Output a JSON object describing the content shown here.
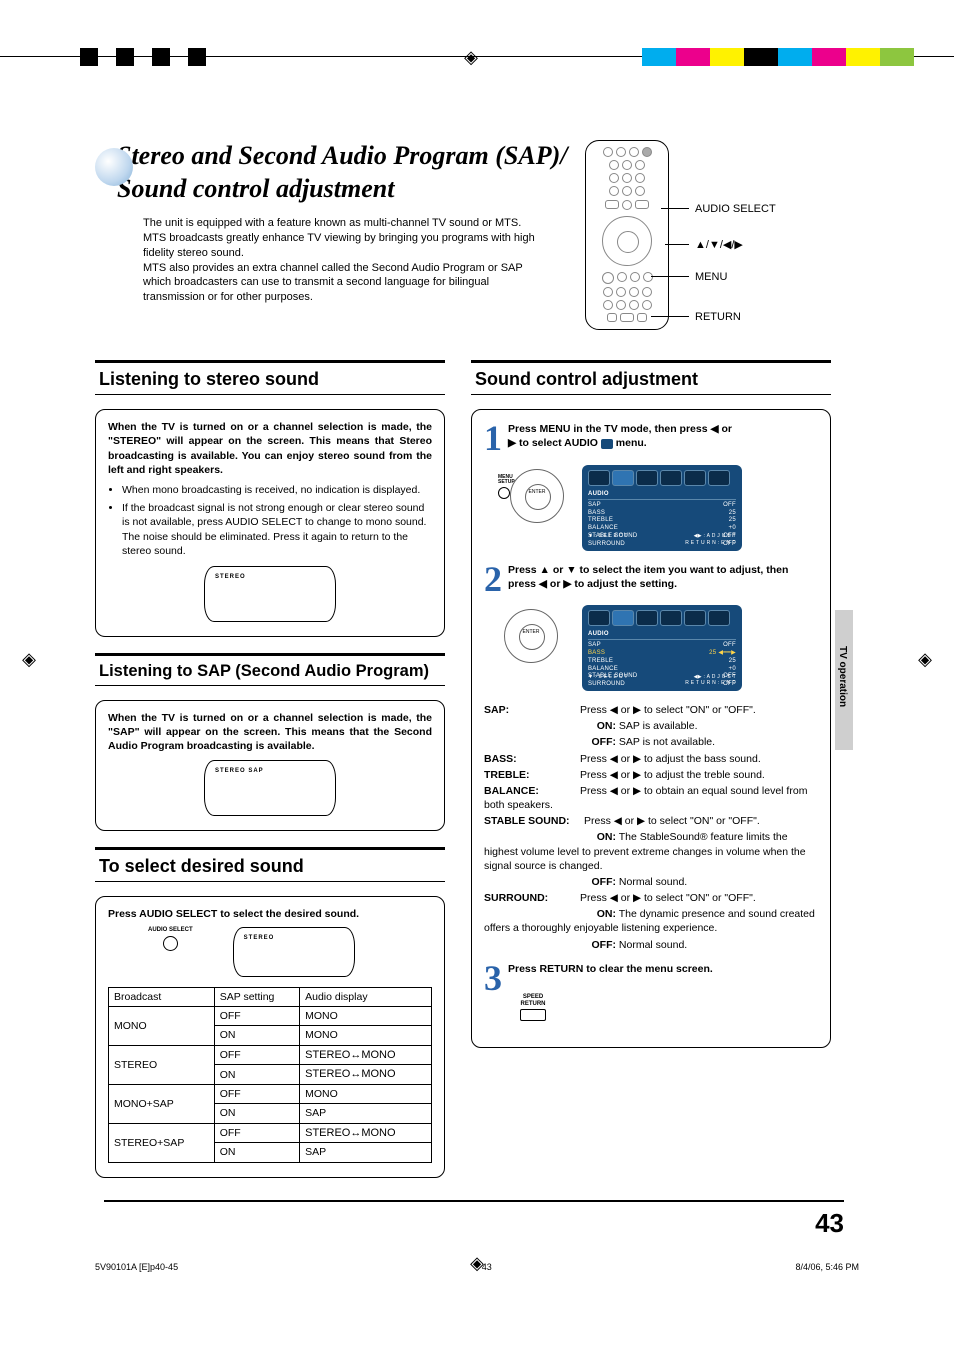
{
  "topbar": {
    "colors": [
      "#00adee",
      "#ec008c",
      "#fff200",
      "#000000",
      "#00adee",
      "#ec008c",
      "#fff200",
      "#8dc63f"
    ]
  },
  "title_line1": "Stereo and Second Audio Program (SAP)/",
  "title_line2": "Sound control adjustment",
  "intro": "The unit is equipped with a feature known as multi-channel TV sound or MTS. MTS broadcasts greatly enhance TV viewing by bringing you programs with high fidelity stereo sound.\nMTS also provides an extra channel called the Second Audio Program or SAP which broadcasters can use to transmit a second language for bilingual transmission or for other purposes.",
  "remote_labels": {
    "audio_select": "AUDIO SELECT",
    "arrows": "▲/▼/◀/▶",
    "menu": "MENU",
    "return": "RETURN"
  },
  "left": {
    "stereo_head": "Listening to stereo sound",
    "stereo_lead": "When the TV is turned on or a channel selection is made, the \"STEREO\" will appear on the screen. This means that Stereo broadcasting is available. You can enjoy stereo sound from the left and right speakers.",
    "stereo_bullets": [
      "When mono broadcasting is received, no indication is displayed.",
      "If the broadcast signal is not strong enough or clear stereo sound is not available, press AUDIO SELECT to change to mono sound. The noise should be eliminated. Press it again to return to the stereo sound."
    ],
    "stereo_screen": "STEREO",
    "sap_head": "Listening to SAP (Second Audio Program)",
    "sap_lead": "When the TV is turned on or a channel selection is made, the \"SAP\" will appear on the screen. This means that the Second Audio Program broadcasting is available.",
    "sap_screen": "STEREO SAP",
    "select_head": "To select desired sound",
    "select_instr": "Press AUDIO SELECT to select the desired sound.",
    "audio_select_btn": "AUDIO SELECT",
    "select_screen": "STEREO",
    "table": {
      "headers": [
        "Broadcast",
        "SAP setting",
        "Audio display"
      ],
      "rows": [
        [
          "MONO",
          "OFF",
          "MONO"
        ],
        [
          "",
          "ON",
          "MONO"
        ],
        [
          "STEREO",
          "OFF",
          "STEREO↔MONO"
        ],
        [
          "",
          "ON",
          "STEREO↔MONO"
        ],
        [
          "MONO+SAP",
          "OFF",
          "MONO"
        ],
        [
          "",
          "ON",
          "SAP"
        ],
        [
          "STEREO+SAP",
          "OFF",
          "STEREO↔MONO"
        ],
        [
          "",
          "ON",
          "SAP"
        ]
      ]
    }
  },
  "right": {
    "head": "Sound control adjustment",
    "step1_num": "1",
    "step1_txt_a": "Press MENU in the TV mode, then press ◀ or",
    "step1_txt_b": "▶ to select AUDIO ",
    "step1_txt_c": " menu.",
    "menu_setup_label": "MENU\nSETUP",
    "osd1": {
      "title": "AUDIO",
      "rows": [
        [
          "SAP",
          "OFF"
        ],
        [
          "BASS",
          "25"
        ],
        [
          "TREBLE",
          "25"
        ],
        [
          "BALANCE",
          "+0"
        ],
        [
          "STABLE SOUND",
          "OFF"
        ],
        [
          "SURROUND",
          "OFF"
        ]
      ],
      "foot_l": "▼ : S E L E C T",
      "foot_r1": "◀▶ : A D J U S T",
      "foot_r2": "R E T U R N : E N D"
    },
    "step2_num": "2",
    "step2_txt": "Press ▲ or ▼ to select the item you want to adjust, then press ◀ or ▶ to adjust the setting.",
    "osd2": {
      "title": "AUDIO",
      "rows": [
        [
          "SAP",
          "OFF"
        ],
        [
          "BASS",
          "25 ◀━━▶"
        ],
        [
          "TREBLE",
          "25"
        ],
        [
          "BALANCE",
          "+0"
        ],
        [
          "STABLE SOUND",
          "OFF"
        ],
        [
          "SURROUND",
          "OFF"
        ]
      ],
      "foot_l": "▼ : S E L E C T",
      "foot_r1": "◀▶ : A D J U S T",
      "foot_r2": "R E T U R N : E N D"
    },
    "defs": {
      "sap_lbl": "SAP:",
      "sap_txt": "Press ◀ or ▶ to select \"ON\" or \"OFF\".",
      "sap_on_lbl": "ON:",
      "sap_on_txt": "SAP is available.",
      "sap_off_lbl": "OFF:",
      "sap_off_txt": "SAP is not available.",
      "bass_lbl": "BASS:",
      "bass_txt": "Press ◀ or ▶ to adjust the bass sound.",
      "treble_lbl": "TREBLE:",
      "treble_txt": "Press ◀ or ▶ to adjust the treble sound.",
      "balance_lbl": "BALANCE:",
      "balance_txt": "Press ◀ or ▶ to obtain an equal sound level from both speakers.",
      "stable_lbl": "STABLE SOUND:",
      "stable_txt": "Press ◀ or ▶ to select \"ON\" or \"OFF\".",
      "stable_on_lbl": "ON:",
      "stable_on_txt": "The StableSound® feature limits the highest volume level to prevent extreme changes in volume when the signal source is changed.",
      "stable_off_lbl": "OFF:",
      "stable_off_txt": "Normal sound.",
      "surround_lbl": "SURROUND:",
      "surround_txt": "Press ◀ or ▶ to select \"ON\" or \"OFF\".",
      "surround_on_lbl": "ON:",
      "surround_on_txt": "The dynamic presence and sound created offers a thoroughly enjoyable listening experience.",
      "surround_off_lbl": "OFF:",
      "surround_off_txt": "Normal sound."
    },
    "step3_num": "3",
    "step3_txt": "Press RETURN to clear the menu screen.",
    "return_btn": "SPEED\nRETURN"
  },
  "side_tab": "TV operation",
  "page_number": "43",
  "footer": {
    "left": "5V90101A [E]p40-45",
    "center": "43",
    "right": "8/4/06, 5:46 PM"
  },
  "reg_glyph": "◈"
}
